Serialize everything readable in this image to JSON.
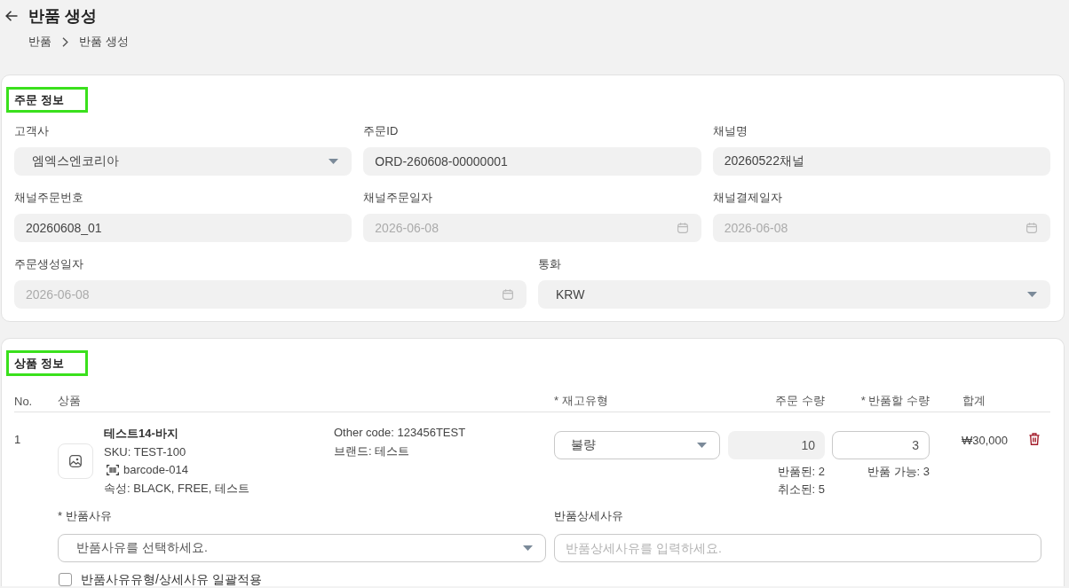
{
  "header": {
    "title": "반품 생성"
  },
  "breadcrumb": [
    "반품",
    "반품 생성"
  ],
  "order_info": {
    "title": "주문 정보",
    "rows": [
      [
        {
          "label": "고객사",
          "kind": "select",
          "value": "엠엑스엔코리아",
          "disabled": false
        },
        {
          "label": "주문ID",
          "kind": "text",
          "value": "ORD-260608-00000001",
          "disabled": false
        },
        {
          "label": "채널명",
          "kind": "text",
          "value": "20260522채널",
          "disabled": false
        }
      ],
      [
        {
          "label": "채널주문번호",
          "kind": "text",
          "value": "20260608_01",
          "disabled": false
        },
        {
          "label": "채널주문일자",
          "kind": "date",
          "value": "2026-06-08",
          "disabled": true
        },
        {
          "label": "채널결제일자",
          "kind": "date",
          "value": "2026-06-08",
          "disabled": true
        }
      ],
      [
        {
          "label": "주문생성일자",
          "kind": "date",
          "value": "2026-06-08",
          "disabled": true
        },
        {
          "label": "통화",
          "kind": "select",
          "value": "KRW",
          "disabled": false
        }
      ]
    ]
  },
  "product_info": {
    "title": "상품 정보",
    "table": {
      "columns": [
        "No.",
        "상품",
        "* 재고유형",
        "주문 수량",
        "* 반품할 수량",
        "합계"
      ],
      "rows": [
        {
          "no": "1",
          "product": {
            "name": "테스트14-바지",
            "sku": "SKU: TEST-100",
            "barcode": "barcode-014",
            "attributes": "속성: BLACK, FREE, 테스트",
            "other_code": "Other code: 123456TEST",
            "brand": "브랜드: 테스트"
          },
          "stock_type": "불량",
          "order_qty": "10",
          "returned": "반품된: 2",
          "cancelled": "취소된: 5",
          "return_qty": "3",
          "returnable": "반품 가능: 3",
          "total": "₩30,000",
          "reason": {
            "label": "* 반품사유",
            "placeholder": "반품사유를 선택하세요."
          },
          "reason_detail": {
            "label": "반품상세사유",
            "placeholder": "반품상세사유를 입력하세요."
          },
          "apply_to_all": {
            "label": "반품사유유형/상세사유 일괄적용",
            "checked": false
          }
        }
      ]
    }
  }
}
